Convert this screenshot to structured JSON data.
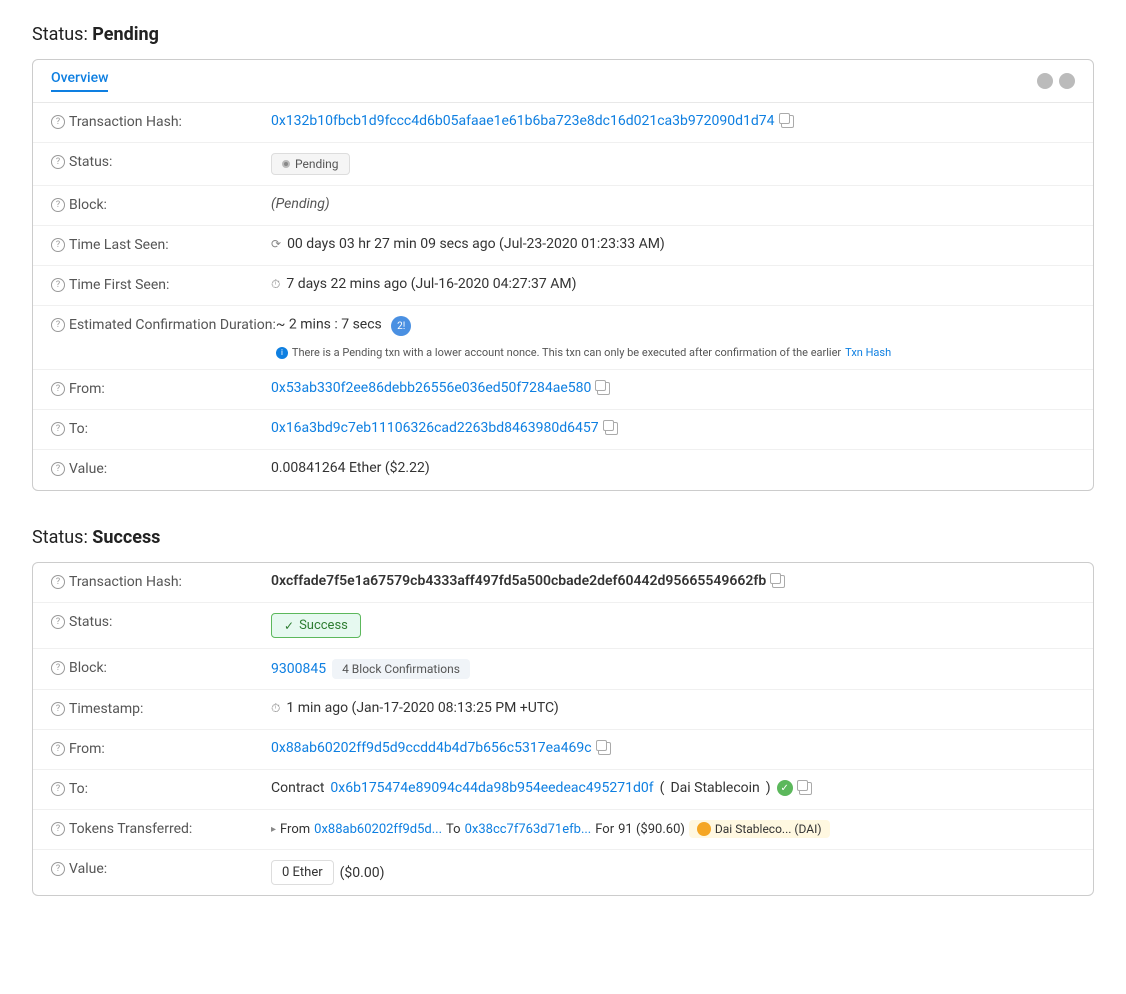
{
  "pending_section": {
    "title": "Status:",
    "title_bold": "Pending",
    "tab_label": "Overview",
    "rows": [
      {
        "label": "Transaction Hash:",
        "type": "hash_link",
        "value": "0x132b10fbcb1d9fccc4d6b05afaae1e61b6ba723e8dc16d021ca3b972090d1d74",
        "copy": true
      },
      {
        "label": "Status:",
        "type": "badge_pending",
        "value": "Pending"
      },
      {
        "label": "Block:",
        "type": "italic",
        "value": "(Pending)"
      },
      {
        "label": "Time Last Seen:",
        "type": "time",
        "value": "00 days 03 hr 27 min 09 secs ago (Jul-23-2020 01:23:33 AM)"
      },
      {
        "label": "Time First Seen:",
        "type": "time",
        "value": "7 days 22 mins ago (Jul-16-2020 04:27:37 AM)"
      },
      {
        "label": "Estimated Confirmation Duration:",
        "type": "duration",
        "value": "~ 2 mins : 7 secs",
        "note": "There is a Pending txn with a lower account nonce. This txn can only be executed after confirmation of the earlier",
        "note_link": "Txn Hash"
      },
      {
        "label": "From:",
        "type": "address_link",
        "value": "0x53ab330f2ee86debb26556e036ed50f7284ae580",
        "copy": true
      },
      {
        "label": "To:",
        "type": "address_link",
        "value": "0x16a3bd9c7eb11106326cad2263bd8463980d6457",
        "copy": true
      },
      {
        "label": "Value:",
        "type": "plain",
        "value": "0.00841264 Ether ($2.22)"
      }
    ]
  },
  "success_section": {
    "title": "Status:",
    "title_bold": "Success",
    "rows": [
      {
        "label": "Transaction Hash:",
        "type": "hash_bold",
        "value": "0xcffade7f5e1a67579cb4333aff497fd5a500cbade2def60442d95665549662fb",
        "copy": true
      },
      {
        "label": "Status:",
        "type": "badge_success",
        "value": "Success"
      },
      {
        "label": "Block:",
        "type": "block",
        "block_value": "9300845",
        "confirm_value": "4 Block Confirmations"
      },
      {
        "label": "Timestamp:",
        "type": "timestamp",
        "value": "1 min ago (Jan-17-2020 08:13:25 PM +UTC)"
      },
      {
        "label": "From:",
        "type": "address_link",
        "value": "0x88ab60202ff9d5d9ccdd4b4d7b656c5317ea469c",
        "copy": true
      },
      {
        "label": "To:",
        "type": "contract",
        "prefix": "Contract",
        "contract_link": "0x6b175474e89094c44da98b954eedeac495271d0f",
        "contract_name": "Dai Stablecoin",
        "verified": true,
        "copy": true
      },
      {
        "label": "Tokens Transferred:",
        "type": "tokens",
        "from_addr": "0x88ab60202ff9d5d...",
        "to_addr": "0x38cc7f763d71efb...",
        "amount": "91 ($90.60)",
        "token_name": "Dai Stableco... (DAI)"
      },
      {
        "label": "Value:",
        "type": "value_box",
        "box_value": "0 Ether",
        "extra": "($0.00)"
      }
    ]
  },
  "icons": {
    "question": "?",
    "copy": "⧉",
    "check": "✓",
    "clock": "⏱",
    "spinner": "⟳",
    "arrow": "▸",
    "info": "i"
  }
}
